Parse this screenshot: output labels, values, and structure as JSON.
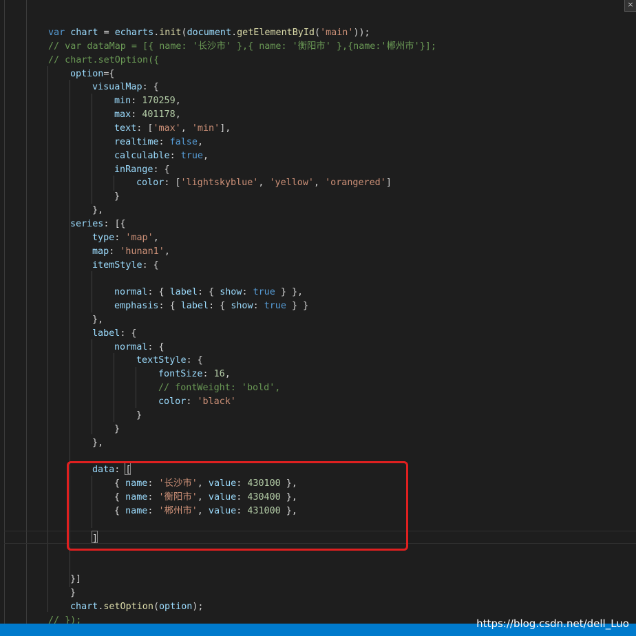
{
  "editor": {
    "lines": [
      [
        {
          "c": "kw",
          "t": "var"
        },
        {
          "c": "pn",
          "t": " "
        },
        {
          "c": "var",
          "t": "chart"
        },
        {
          "c": "pn",
          "t": " = "
        },
        {
          "c": "var",
          "t": "echarts"
        },
        {
          "c": "pn",
          "t": "."
        },
        {
          "c": "fn",
          "t": "init"
        },
        {
          "c": "pn",
          "t": "("
        },
        {
          "c": "var",
          "t": "document"
        },
        {
          "c": "pn",
          "t": "."
        },
        {
          "c": "fn",
          "t": "getElementById"
        },
        {
          "c": "pn",
          "t": "("
        },
        {
          "c": "str",
          "t": "'main'"
        },
        {
          "c": "pn",
          "t": "));"
        }
      ],
      [
        {
          "c": "cm",
          "t": "// var dataMap = [{ name: '长沙市' },{ name: '衡阳市' },{name:'郴州市'}];"
        }
      ],
      [
        {
          "c": "cm",
          "t": "// chart.setOption({"
        }
      ],
      [
        {
          "c": "var",
          "t": "option"
        },
        {
          "c": "pn",
          "t": "={"
        }
      ],
      [
        {
          "c": "var",
          "t": "visualMap"
        },
        {
          "c": "pn",
          "t": ": {"
        }
      ],
      [
        {
          "c": "var",
          "t": "min"
        },
        {
          "c": "pn",
          "t": ": "
        },
        {
          "c": "num",
          "t": "170259"
        },
        {
          "c": "pn",
          "t": ","
        }
      ],
      [
        {
          "c": "var",
          "t": "max"
        },
        {
          "c": "pn",
          "t": ": "
        },
        {
          "c": "num",
          "t": "401178"
        },
        {
          "c": "pn",
          "t": ","
        }
      ],
      [
        {
          "c": "var",
          "t": "text"
        },
        {
          "c": "pn",
          "t": ": ["
        },
        {
          "c": "str",
          "t": "'max'"
        },
        {
          "c": "pn",
          "t": ", "
        },
        {
          "c": "str",
          "t": "'min'"
        },
        {
          "c": "pn",
          "t": "],"
        }
      ],
      [
        {
          "c": "var",
          "t": "realtime"
        },
        {
          "c": "pn",
          "t": ": "
        },
        {
          "c": "kw",
          "t": "false"
        },
        {
          "c": "pn",
          "t": ","
        }
      ],
      [
        {
          "c": "var",
          "t": "calculable"
        },
        {
          "c": "pn",
          "t": ": "
        },
        {
          "c": "kw",
          "t": "true"
        },
        {
          "c": "pn",
          "t": ","
        }
      ],
      [
        {
          "c": "var",
          "t": "inRange"
        },
        {
          "c": "pn",
          "t": ": {"
        }
      ],
      [
        {
          "c": "var",
          "t": "color"
        },
        {
          "c": "pn",
          "t": ": ["
        },
        {
          "c": "str",
          "t": "'lightskyblue'"
        },
        {
          "c": "pn",
          "t": ", "
        },
        {
          "c": "str",
          "t": "'yellow'"
        },
        {
          "c": "pn",
          "t": ", "
        },
        {
          "c": "str",
          "t": "'orangered'"
        },
        {
          "c": "pn",
          "t": "]"
        }
      ],
      [
        {
          "c": "pn",
          "t": "}"
        }
      ],
      [
        {
          "c": "pn",
          "t": "},"
        }
      ],
      [
        {
          "c": "var",
          "t": "series"
        },
        {
          "c": "pn",
          "t": ": [{"
        }
      ],
      [
        {
          "c": "var",
          "t": "type"
        },
        {
          "c": "pn",
          "t": ": "
        },
        {
          "c": "str",
          "t": "'map'"
        },
        {
          "c": "pn",
          "t": ","
        }
      ],
      [
        {
          "c": "var",
          "t": "map"
        },
        {
          "c": "pn",
          "t": ": "
        },
        {
          "c": "str",
          "t": "'hunan1'"
        },
        {
          "c": "pn",
          "t": ","
        }
      ],
      [
        {
          "c": "var",
          "t": "itemStyle"
        },
        {
          "c": "pn",
          "t": ": {"
        }
      ],
      [],
      [
        {
          "c": "var",
          "t": "normal"
        },
        {
          "c": "pn",
          "t": ": { "
        },
        {
          "c": "var",
          "t": "label"
        },
        {
          "c": "pn",
          "t": ": { "
        },
        {
          "c": "var",
          "t": "show"
        },
        {
          "c": "pn",
          "t": ": "
        },
        {
          "c": "kw",
          "t": "true"
        },
        {
          "c": "pn",
          "t": " } },"
        }
      ],
      [
        {
          "c": "var",
          "t": "emphasis"
        },
        {
          "c": "pn",
          "t": ": { "
        },
        {
          "c": "var",
          "t": "label"
        },
        {
          "c": "pn",
          "t": ": { "
        },
        {
          "c": "var",
          "t": "show"
        },
        {
          "c": "pn",
          "t": ": "
        },
        {
          "c": "kw",
          "t": "true"
        },
        {
          "c": "pn",
          "t": " } }"
        }
      ],
      [
        {
          "c": "pn",
          "t": "},"
        }
      ],
      [
        {
          "c": "var",
          "t": "label"
        },
        {
          "c": "pn",
          "t": ": {"
        }
      ],
      [
        {
          "c": "var",
          "t": "normal"
        },
        {
          "c": "pn",
          "t": ": {"
        }
      ],
      [
        {
          "c": "var",
          "t": "textStyle"
        },
        {
          "c": "pn",
          "t": ": {"
        }
      ],
      [
        {
          "c": "var",
          "t": "fontSize"
        },
        {
          "c": "pn",
          "t": ": "
        },
        {
          "c": "num",
          "t": "16"
        },
        {
          "c": "pn",
          "t": ","
        }
      ],
      [
        {
          "c": "cm",
          "t": "// fontWeight: 'bold',"
        }
      ],
      [
        {
          "c": "var",
          "t": "color"
        },
        {
          "c": "pn",
          "t": ": "
        },
        {
          "c": "str",
          "t": "'black'"
        }
      ],
      [
        {
          "c": "pn",
          "t": "}"
        }
      ],
      [
        {
          "c": "pn",
          "t": "}"
        }
      ],
      [
        {
          "c": "pn",
          "t": "},"
        }
      ],
      [],
      [
        {
          "c": "var",
          "t": "data"
        },
        {
          "c": "pn",
          "t": ": ["
        }
      ],
      [
        {
          "c": "pn",
          "t": "{ "
        },
        {
          "c": "var",
          "t": "name"
        },
        {
          "c": "pn",
          "t": ": "
        },
        {
          "c": "str",
          "t": "'长沙市'"
        },
        {
          "c": "pn",
          "t": ", "
        },
        {
          "c": "var",
          "t": "value"
        },
        {
          "c": "pn",
          "t": ": "
        },
        {
          "c": "num",
          "t": "430100"
        },
        {
          "c": "pn",
          "t": " },"
        }
      ],
      [
        {
          "c": "pn",
          "t": "{ "
        },
        {
          "c": "var",
          "t": "name"
        },
        {
          "c": "pn",
          "t": ": "
        },
        {
          "c": "str",
          "t": "'衡阳市'"
        },
        {
          "c": "pn",
          "t": ", "
        },
        {
          "c": "var",
          "t": "value"
        },
        {
          "c": "pn",
          "t": ": "
        },
        {
          "c": "num",
          "t": "430400"
        },
        {
          "c": "pn",
          "t": " },"
        }
      ],
      [
        {
          "c": "pn",
          "t": "{ "
        },
        {
          "c": "var",
          "t": "name"
        },
        {
          "c": "pn",
          "t": ": "
        },
        {
          "c": "str",
          "t": "'郴州市'"
        },
        {
          "c": "pn",
          "t": ", "
        },
        {
          "c": "var",
          "t": "value"
        },
        {
          "c": "pn",
          "t": ": "
        },
        {
          "c": "num",
          "t": "431000"
        },
        {
          "c": "pn",
          "t": " },"
        }
      ],
      [],
      [
        {
          "c": "pn",
          "t": "]"
        }
      ],
      [],
      [],
      [
        {
          "c": "pn",
          "t": "}]"
        }
      ],
      [
        {
          "c": "pn",
          "t": "}"
        }
      ],
      [
        {
          "c": "var",
          "t": "chart"
        },
        {
          "c": "pn",
          "t": "."
        },
        {
          "c": "fn",
          "t": "setOption"
        },
        {
          "c": "pn",
          "t": "("
        },
        {
          "c": "var",
          "t": "option"
        },
        {
          "c": "pn",
          "t": ");"
        }
      ],
      [
        {
          "c": "cm",
          "t": "// });"
        }
      ]
    ]
  },
  "corner_icon": "close-icon",
  "corner_glyph": "×",
  "watermark": "https://blog.csdn.net/dell_Luo",
  "colors": {
    "background": "#1e1e1e",
    "keyword": "#569cd6",
    "variable": "#9cdcfe",
    "function": "#dcdcaa",
    "string": "#ce9178",
    "number": "#b5cea8",
    "comment": "#6a9955",
    "highlight_box": "#e02020",
    "status_bar": "#007acc"
  }
}
